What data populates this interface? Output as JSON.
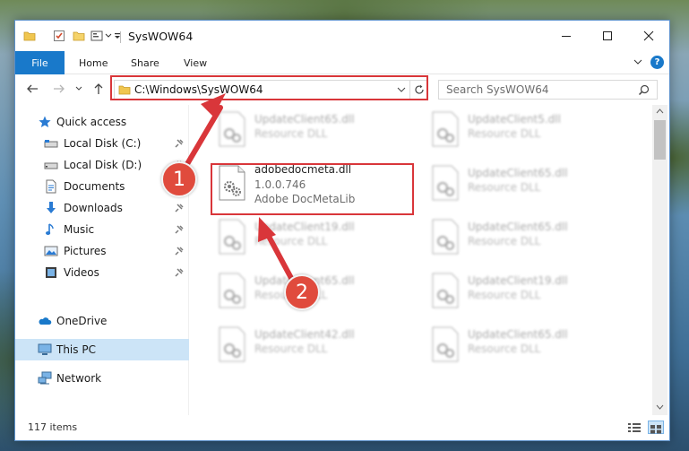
{
  "window": {
    "title": "SysWOW64",
    "controls": {
      "minimize": "minimize",
      "maximize": "maximize",
      "close": "close"
    }
  },
  "ribbon": {
    "tabs": [
      {
        "label": "File",
        "active": true
      },
      {
        "label": "Home"
      },
      {
        "label": "Share"
      },
      {
        "label": "View"
      }
    ],
    "help": "?"
  },
  "navigation": {
    "address": "C:\\Windows\\SysWOW64",
    "search_placeholder": "Search SysWOW64"
  },
  "sidebar": {
    "items": [
      {
        "label": "Quick access",
        "icon": "star-icon"
      },
      {
        "label": "Local Disk (C:)",
        "icon": "drive-icon",
        "pinned": true
      },
      {
        "label": "Local Disk (D:)",
        "icon": "drive-icon",
        "pinned": true
      },
      {
        "label": "Documents",
        "icon": "documents-icon",
        "pinned": true
      },
      {
        "label": "Downloads",
        "icon": "downloads-icon",
        "pinned": true
      },
      {
        "label": "Music",
        "icon": "music-icon",
        "pinned": true
      },
      {
        "label": "Pictures",
        "icon": "pictures-icon",
        "pinned": true
      },
      {
        "label": "Videos",
        "icon": "videos-icon",
        "pinned": true
      },
      {
        "label": "OneDrive",
        "icon": "cloud-icon"
      },
      {
        "label": "This PC",
        "icon": "computer-icon",
        "selected": true
      },
      {
        "label": "Network",
        "icon": "network-icon"
      }
    ]
  },
  "files": {
    "left_column": [
      {
        "name": "UpdateClient65.dll",
        "type": "Resource DLL"
      },
      {
        "name": "adobedocmeta.dll",
        "version": "1.0.0.746",
        "description": "Adobe DocMetaLib"
      },
      {
        "name": "UpdateClient19.dll",
        "type": "Resource DLL"
      },
      {
        "name": "UpdateClient65.dll",
        "type": "Resource DLL"
      },
      {
        "name": "UpdateClient42.dll",
        "type": "Resource DLL"
      }
    ],
    "right_column": [
      {
        "name": "UpdateClient5.dll",
        "type": "Resource DLL"
      },
      {
        "name": "UpdateClient65.dll",
        "type": "Resource DLL"
      },
      {
        "name": "UpdateClient65.dll",
        "type": "Resource DLL"
      },
      {
        "name": "UpdateClient19.dll",
        "type": "Resource DLL"
      },
      {
        "name": "UpdateClient65.dll",
        "type": "Resource DLL"
      }
    ]
  },
  "status": {
    "item_count": "117 items"
  },
  "annotations": {
    "badge_1": "1",
    "badge_2": "2",
    "color": "#d9363a"
  },
  "colors": {
    "accent": "#1979ca",
    "selected": "#cce4f7"
  }
}
